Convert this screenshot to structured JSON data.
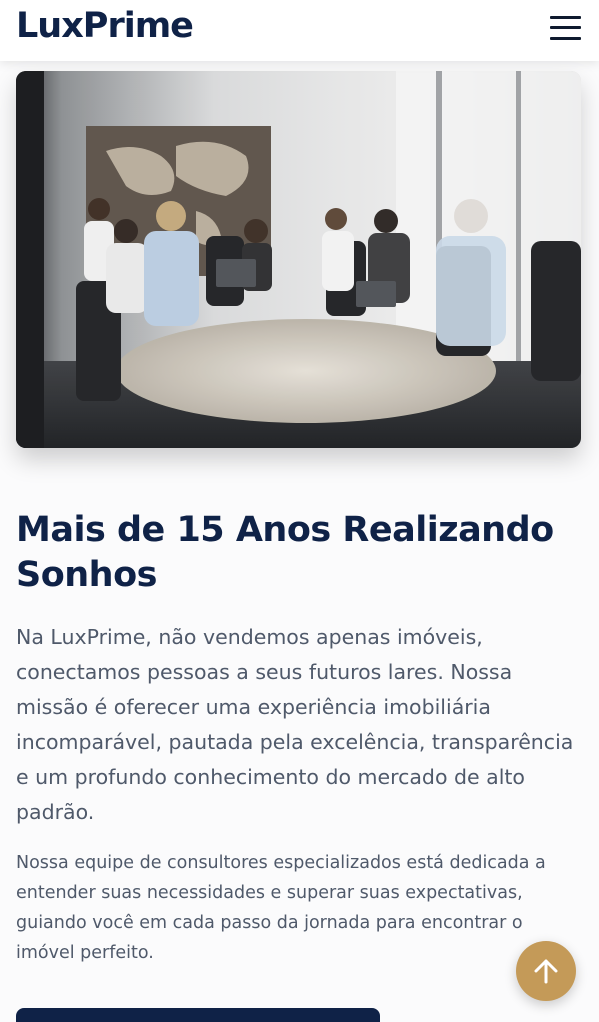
{
  "header": {
    "logo_text": "LuxPrime",
    "menu_icon": "hamburger-menu-icon"
  },
  "hero": {
    "image_subject": "office-meeting-photo"
  },
  "about": {
    "title": "Mais de 15 Anos Realizando Sonhos",
    "lead": "Na LuxPrime, não vendemos apenas imóveis, conectamos pessoas a seus futuros lares. Nossa missão é oferecer uma experiência imobiliária incomparável, pautada pela excelência, transparência e um profundo conhecimento do mercado de alto padrão.",
    "body": "Nossa equipe de consultores especializados está dedicada a entender suas necessidades e superar suas expectativas, guiando você em cada passo da jornada para encontrar o imóvel perfeito."
  },
  "scroll_top": {
    "icon": "arrow-up-icon"
  },
  "colors": {
    "brand_navy": "#0f2247",
    "accent_gold": "#c49a58",
    "text_gray": "#4f596a"
  }
}
